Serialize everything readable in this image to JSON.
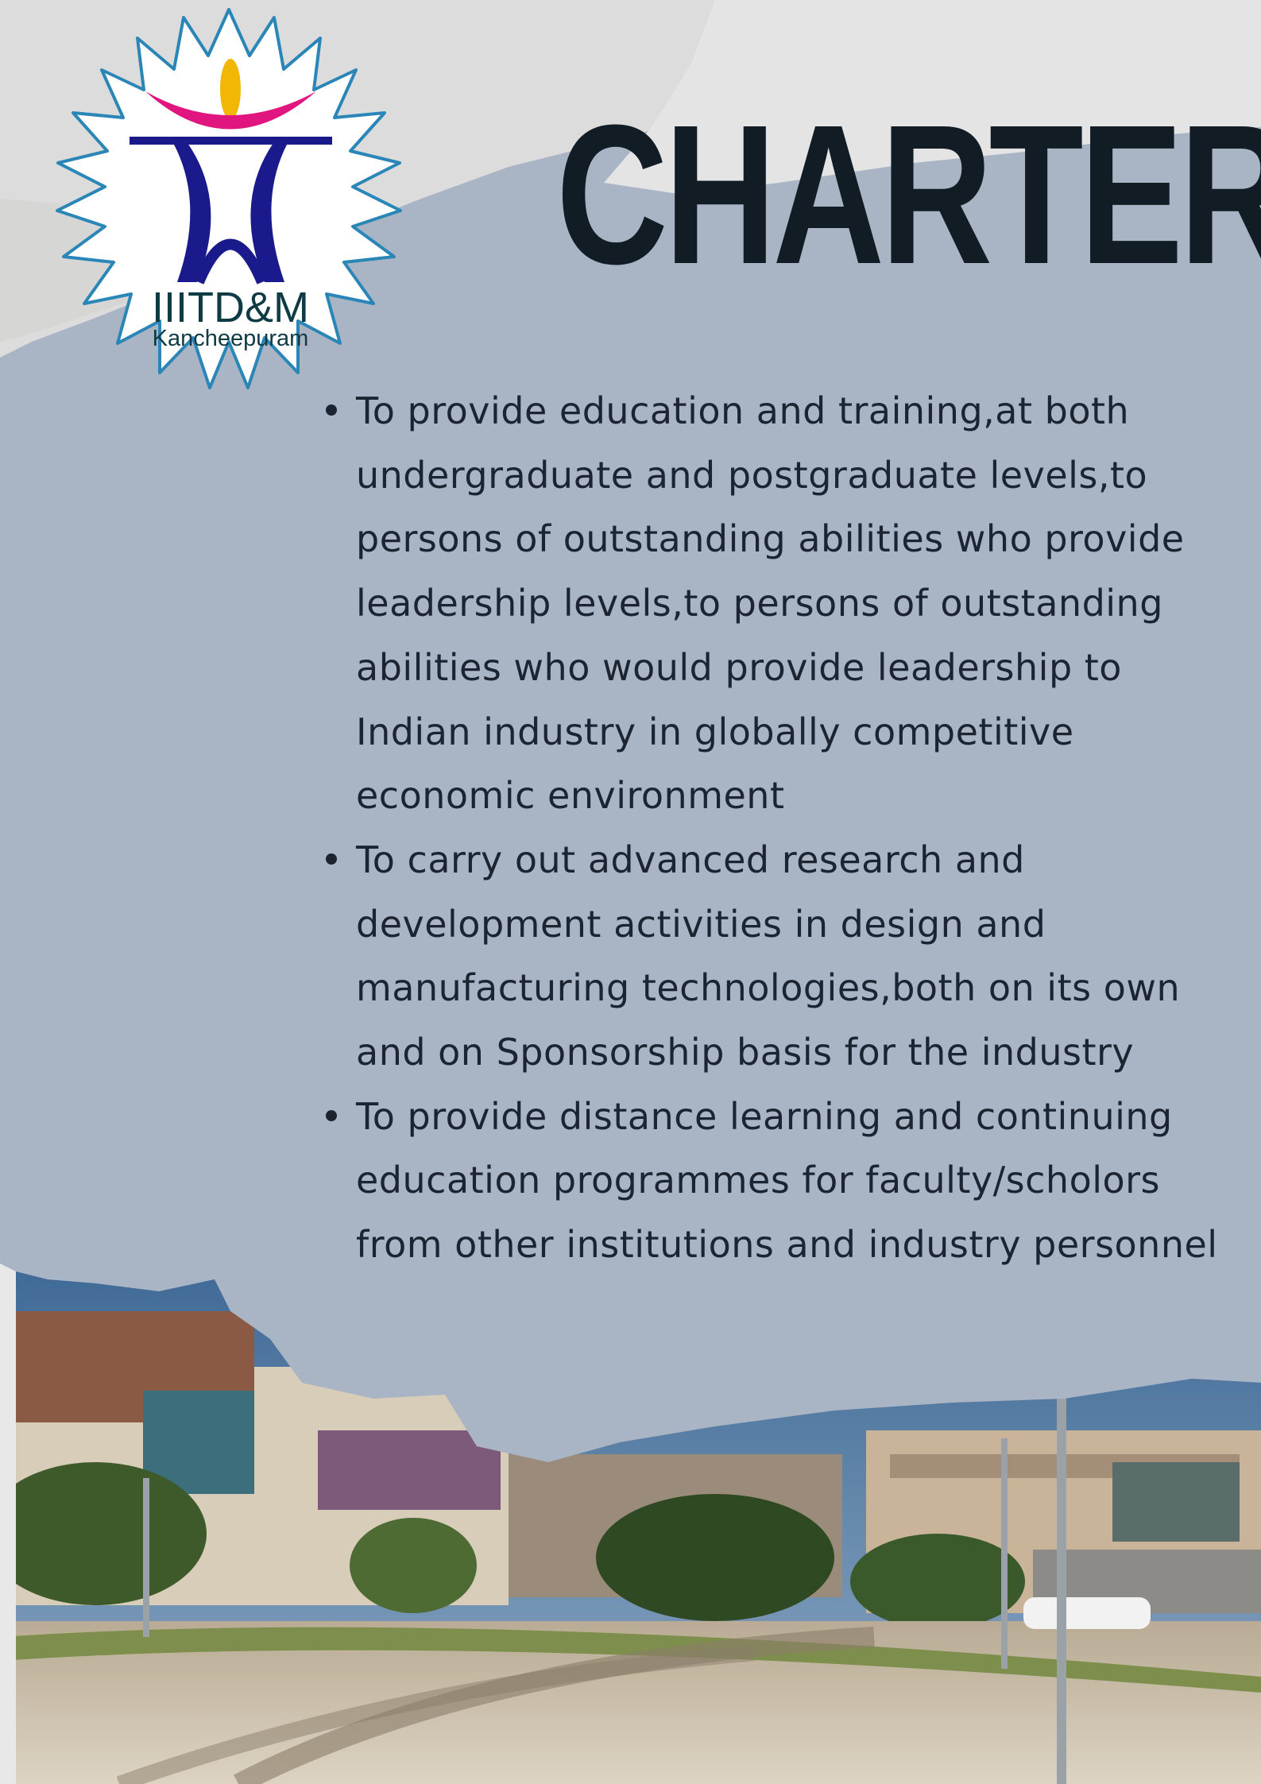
{
  "logo": {
    "name": "IIITD&M",
    "location": "Kancheepuram"
  },
  "title": "CHARTER",
  "charter": {
    "items": [
      {
        "text": "To provide education and training,at both undergraduate and postgraduate levels,to persons of outstanding abilities who provide leadership levels,to persons of outstanding abilities who would provide leadership to Indian industry in globally competitive economic environment"
      },
      {
        "text": "To carry out advanced research and development activities in design and manufacturing technologies,both on its own and on Sponsorship basis for the industry"
      },
      {
        "text": "To provide distance learning and continuing education programmes for faculty/scholors from other institutions and industry personnel"
      }
    ]
  },
  "colors": {
    "background": "#a9b4c5",
    "title": "#121c24",
    "body_text": "#1b2430",
    "logo_gear": "#2b86b8",
    "logo_figure": "#1a1a8c",
    "logo_arc": "#e0157f",
    "logo_head": "#f2b705",
    "logo_text": "#0f3b45"
  },
  "icons": [
    "institute-logo",
    "gear-emblem-icon",
    "campus-photo"
  ]
}
